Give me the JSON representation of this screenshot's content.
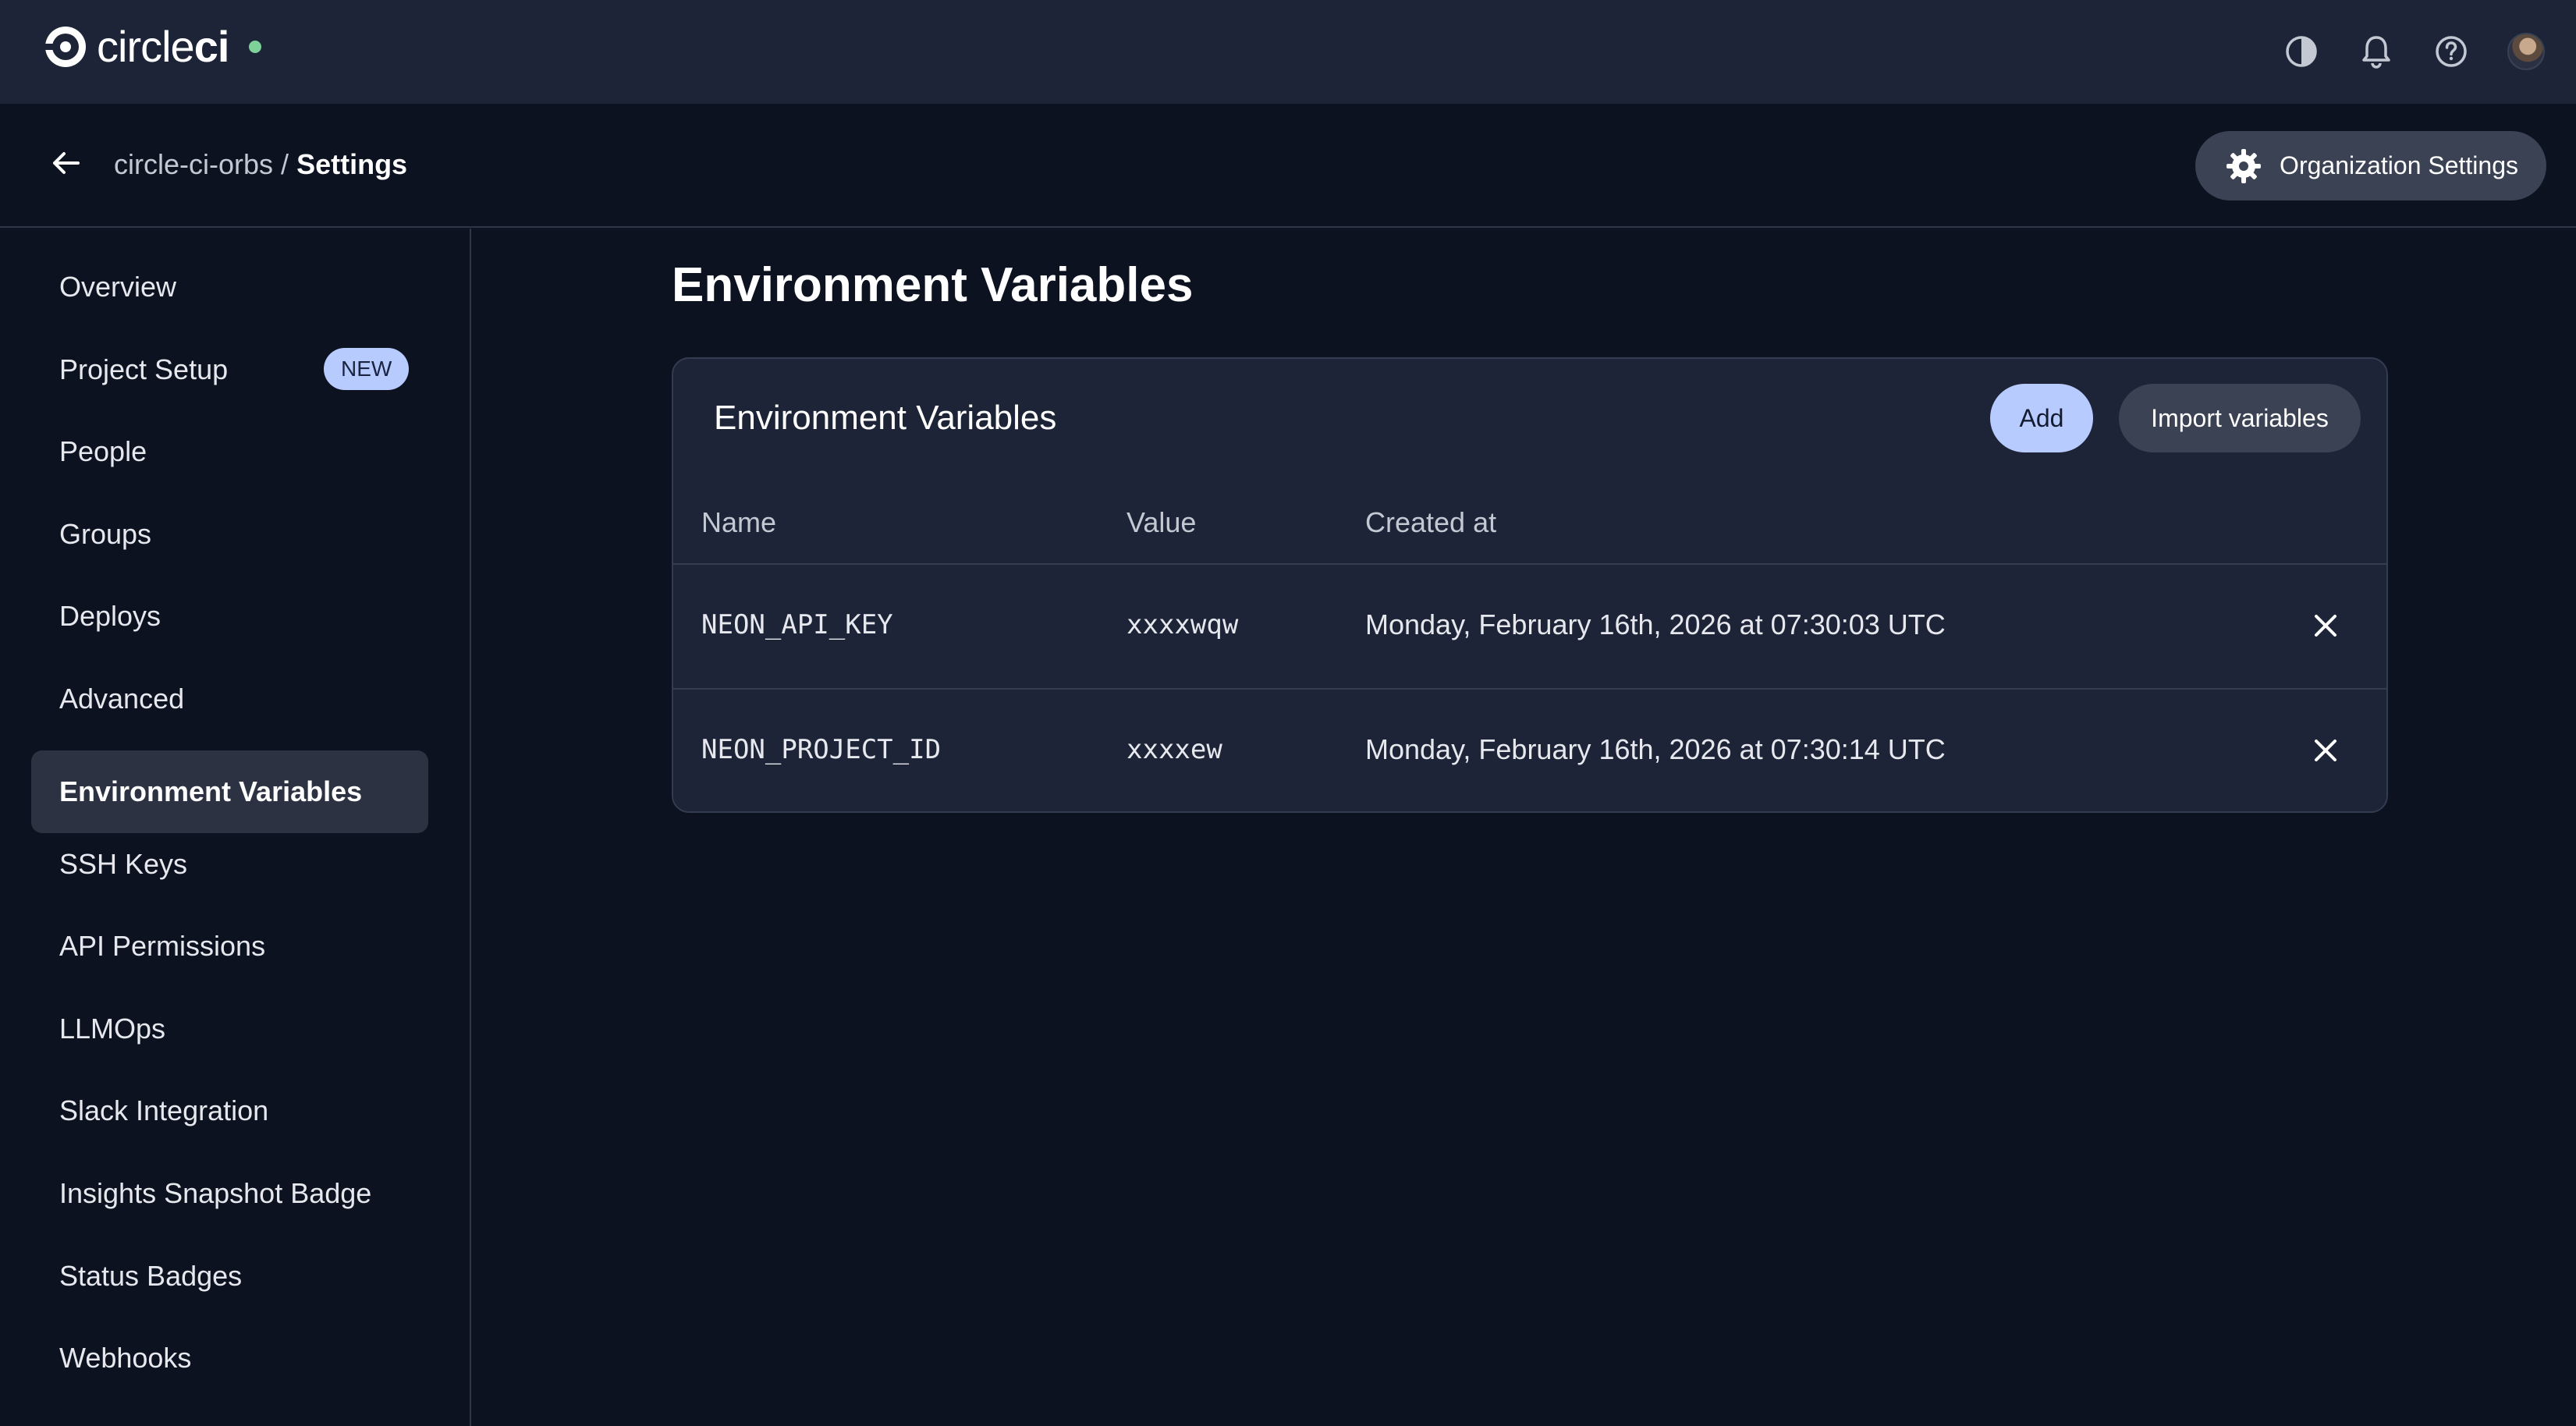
{
  "header": {
    "brand_prefix": "circle",
    "brand_suffix": "ci",
    "icons": [
      "theme-toggle-icon",
      "bell-icon",
      "help-icon",
      "avatar"
    ]
  },
  "subheader": {
    "org": "circle-ci-orbs",
    "separator": "/",
    "current": "Settings",
    "org_settings_label": "Organization Settings"
  },
  "sidebar": {
    "items": [
      {
        "label": "Overview"
      },
      {
        "label": "Project Setup",
        "badge": "NEW"
      },
      {
        "label": "People"
      },
      {
        "label": "Groups"
      },
      {
        "label": "Deploys"
      },
      {
        "label": "Advanced"
      },
      {
        "label": "Environment Variables",
        "active": true
      },
      {
        "label": "SSH Keys"
      },
      {
        "label": "API Permissions"
      },
      {
        "label": "LLMOps"
      },
      {
        "label": "Slack Integration"
      },
      {
        "label": "Insights Snapshot Badge"
      },
      {
        "label": "Status Badges"
      },
      {
        "label": "Webhooks"
      }
    ]
  },
  "main": {
    "page_title": "Environment Variables",
    "panel": {
      "title": "Environment Variables",
      "add_label": "Add",
      "import_label": "Import variables",
      "columns": [
        "Name",
        "Value",
        "Created at"
      ],
      "rows": [
        {
          "name": "NEON_API_KEY",
          "value": "xxxxwqw",
          "created": "Monday, February 16th, 2026 at 07:30:03 UTC"
        },
        {
          "name": "NEON_PROJECT_ID",
          "value": "xxxxew",
          "created": "Monday, February 16th, 2026 at 07:30:14 UTC"
        }
      ]
    }
  },
  "colors": {
    "topbar": "#1d2437",
    "background": "#0d1221",
    "accent": "#b7cbff",
    "status_dot": "#7fd19a"
  }
}
